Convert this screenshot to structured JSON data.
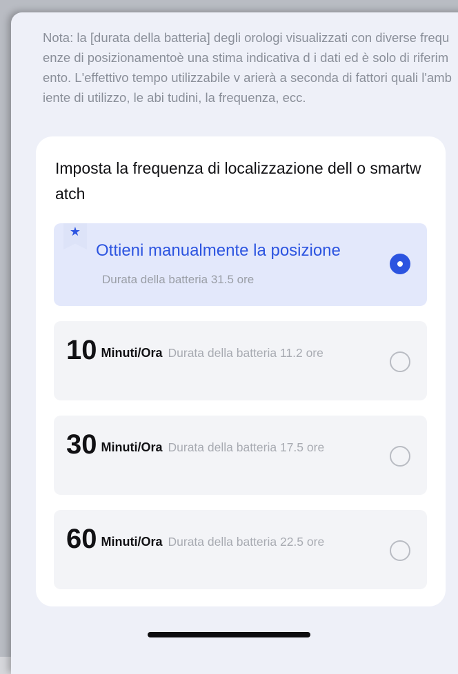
{
  "note": "Nota: la [durata della batteria] degli orologi visualizzati con diverse frequenze di posizionamentoè una stima indicativa d i dati ed è solo di riferimento. L'effettivo tempo utilizzabile v arierà a seconda  di fattori quali l'ambiente di utilizzo, le abi tudini, la frequenza, ecc.",
  "card": {
    "title": "Imposta la frequenza di localizzazione dell o smartwatch",
    "manual": {
      "badge_icon": "★",
      "title": "Ottieni manualmente la posizione",
      "battery": "Durata della batteria 31.5 ore",
      "selected": true
    },
    "options": [
      {
        "number": "10",
        "unit": "Minuti/Ora",
        "battery": "Durata della batteria 11.2 ore",
        "selected": false
      },
      {
        "number": "30",
        "unit": "Minuti/Ora",
        "battery": "Durata della batteria 17.5 ore",
        "selected": false
      },
      {
        "number": "60",
        "unit": "Minuti/Ora",
        "battery": "Durata della batteria 22.5 ore",
        "selected": false
      }
    ]
  },
  "colors": {
    "accent": "#2c54e0",
    "selected_bg": "#e3e8fb",
    "option_bg": "#f3f4f7",
    "page_bg": "#eef0f8"
  }
}
